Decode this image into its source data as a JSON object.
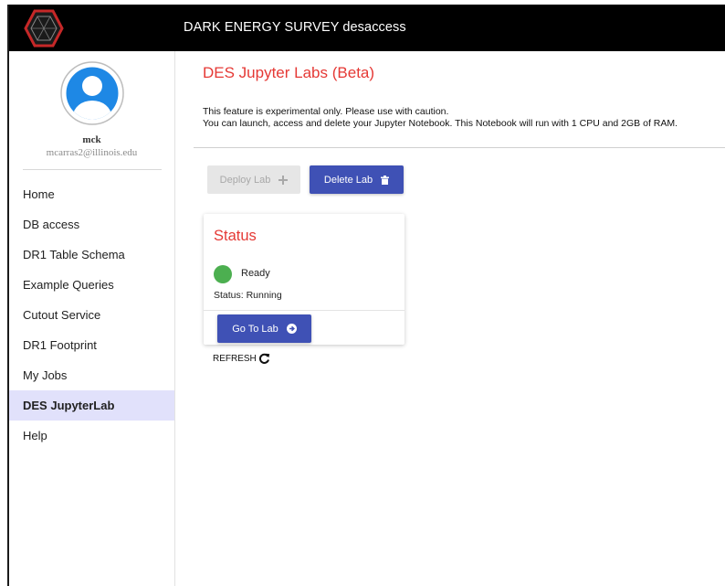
{
  "header": {
    "title": "DARK ENERGY SURVEY desaccess",
    "logo_icon": "des-hexagon-logo-icon",
    "background": "#000000"
  },
  "user": {
    "name": "mck",
    "email": "mcarras2@illinois.edu",
    "avatar_icon": "user-avatar-icon"
  },
  "sidebar": {
    "items": [
      {
        "label": "Home"
      },
      {
        "label": "DB access"
      },
      {
        "label": "DR1 Table Schema"
      },
      {
        "label": "Example Queries"
      },
      {
        "label": "Cutout Service"
      },
      {
        "label": "DR1 Footprint"
      },
      {
        "label": "My Jobs"
      },
      {
        "label": "DES JupyterLab",
        "active": true
      },
      {
        "label": "Help"
      }
    ],
    "active_bg": "#e1e1fb"
  },
  "main": {
    "title": "DES Jupyter Labs (Beta)",
    "description_line1": "This feature is experimental only. Please use with caution.",
    "description_line2": "You can launch, access and delete your Jupyter Notebook. This Notebook will run with 1 CPU and 2GB of RAM.",
    "deploy_button": {
      "label": "Deploy Lab",
      "icon": "plus-icon",
      "disabled": true
    },
    "delete_button": {
      "label": "Delete Lab",
      "icon": "trash-icon"
    },
    "status_card": {
      "title": "Status",
      "indicator_color": "#4caf50",
      "state_text": "Ready",
      "status_text": "Status: Running",
      "goto_button": {
        "label": "Go To Lab",
        "icon": "arrow-circle-right-icon"
      }
    },
    "refresh": {
      "label": "REFRESH",
      "icon": "refresh-icon"
    }
  },
  "colors": {
    "accent_red": "#e53935",
    "primary_blue": "#3f51b5"
  }
}
